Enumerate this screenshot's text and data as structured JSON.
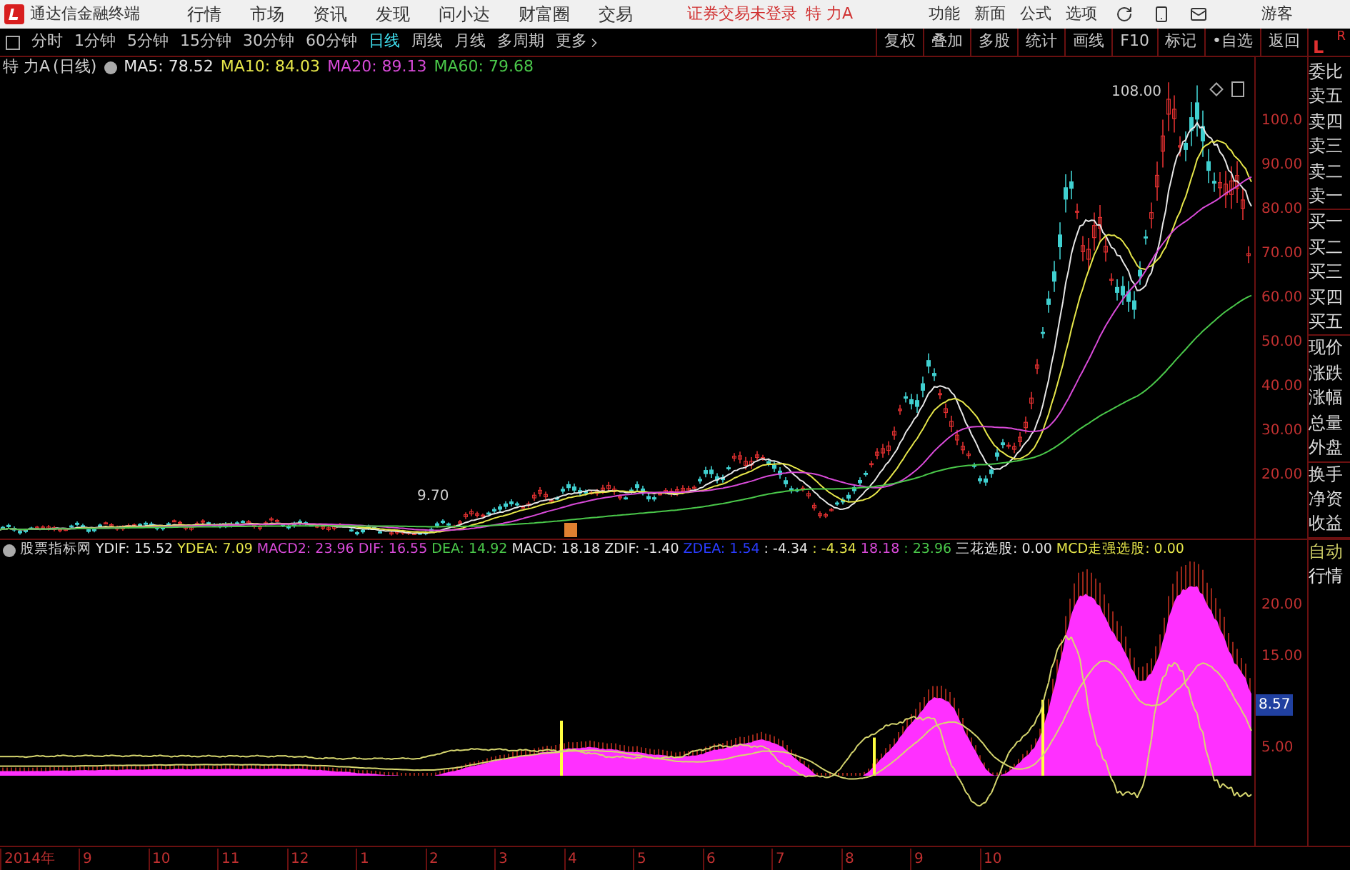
{
  "app": {
    "title": "通达信金融终端",
    "menu": [
      "行情",
      "市场",
      "资讯",
      "发现",
      "问小达",
      "财富圈",
      "交易"
    ],
    "notice": "证券交易未登录",
    "stock_name": "特 力A",
    "actions": [
      "功能",
      "新面",
      "公式",
      "选项"
    ],
    "user": "游客"
  },
  "periods": [
    {
      "label": "分时",
      "selected": false
    },
    {
      "label": "1分钟",
      "selected": false
    },
    {
      "label": "5分钟",
      "selected": false
    },
    {
      "label": "15分钟",
      "selected": false
    },
    {
      "label": "30分钟",
      "selected": false
    },
    {
      "label": "60分钟",
      "selected": false
    },
    {
      "label": "日线",
      "selected": true
    },
    {
      "label": "周线",
      "selected": false
    },
    {
      "label": "月线",
      "selected": false
    },
    {
      "label": "多周期",
      "selected": false
    },
    {
      "label": "更多",
      "selected": false
    }
  ],
  "tools": [
    "复权",
    "叠加",
    "多股",
    "统计",
    "画线",
    "F10",
    "标记",
    "•自选",
    "返回"
  ],
  "price_chart": {
    "title": "特 力A",
    "period": "(日线)",
    "ma": [
      {
        "label": "MA5: 78.52",
        "color": "#e6e6e6"
      },
      {
        "label": "MA10: 84.03",
        "color": "#e6e64a"
      },
      {
        "label": "MA20: 89.13",
        "color": "#d84ad8"
      },
      {
        "label": "MA60: 79.68",
        "color": "#4ac84a"
      }
    ],
    "high_label": "108.00",
    "low_label": "9.70",
    "y_labels": [
      "100.0",
      "90.00",
      "80.00",
      "70.00",
      "60.00",
      "50.00",
      "40.00",
      "30.00",
      "20.00"
    ]
  },
  "panel_tabs": {
    "left": "L",
    "right": "R"
  },
  "quote_fields": [
    "委比",
    "卖五",
    "卖四",
    "卖三",
    "卖二",
    "卖一",
    "买一",
    "买二",
    "买三",
    "买四",
    "买五",
    "现价",
    "涨跌",
    "涨幅",
    "总量",
    "外盘",
    "换手",
    "净资",
    "收益"
  ],
  "indicator": {
    "name": "股票指标网",
    "values": [
      {
        "text": "YDIF: 15.52",
        "color": "#e6e6e6"
      },
      {
        "text": "YDEA: 7.09",
        "color": "#e6e64a"
      },
      {
        "text": "MACD2: 23.96",
        "color": "#d84ad8"
      },
      {
        "text": "DIF: 16.55",
        "color": "#d84ad8"
      },
      {
        "text": "DEA: 14.92",
        "color": "#4ac84a"
      },
      {
        "text": "MACD: 18.18",
        "color": "#e6e6e6"
      },
      {
        "text": "ZDIF: -1.40",
        "color": "#e6e6e6"
      },
      {
        "text": "ZDEA: 1.54",
        "color": "#2a3cff"
      },
      {
        "text": ": -4.34",
        "color": "#e6e6e6"
      },
      {
        "text": ": -4.34",
        "color": "#e6e64a"
      },
      {
        "text": "18.18",
        "color": "#d84ad8"
      },
      {
        "text": ": 23.96",
        "color": "#4ac84a"
      },
      {
        "text": "三花选股: 0.00",
        "color": "#e6e6e6"
      },
      {
        "text": "MCD走强选股: 0.00",
        "color": "#e6e64a"
      }
    ],
    "y_labels": [
      "20.00",
      "15.00",
      "5.00"
    ],
    "current_value": "8.57"
  },
  "mode_buttons": [
    {
      "label": "自动",
      "selected": true
    },
    {
      "label": "行情",
      "selected": false
    }
  ],
  "x_axis": [
    "2014年",
    "9",
    "10",
    "11",
    "12",
    "1",
    "2",
    "3",
    "4",
    "5",
    "6",
    "7",
    "8",
    "9",
    "10"
  ]
}
